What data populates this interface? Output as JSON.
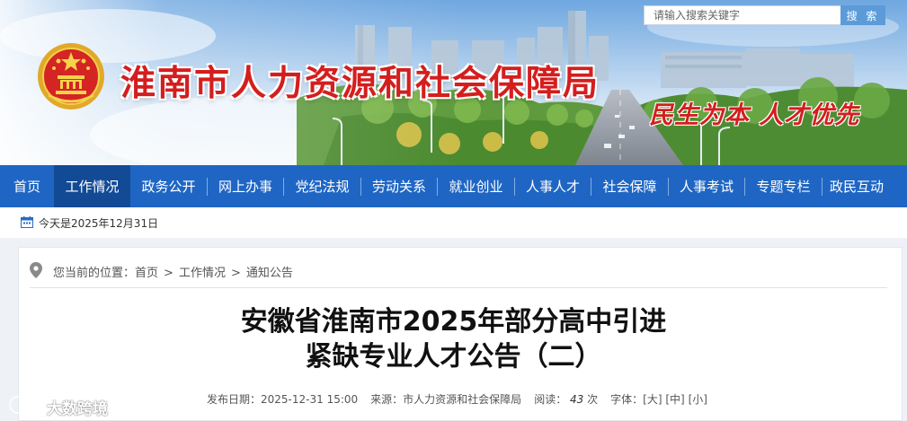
{
  "header": {
    "site_title": "淮南市人力资源和社会保障局",
    "slogan": "民生为本  人才优先",
    "emblem": "national-emblem-icon"
  },
  "nav": {
    "items": [
      {
        "label": "首页",
        "active": false
      },
      {
        "label": "工作情况",
        "active": true
      },
      {
        "label": "政务公开",
        "active": false
      },
      {
        "label": "网上办事",
        "active": false
      },
      {
        "label": "党纪法规",
        "active": false
      },
      {
        "label": "劳动关系",
        "active": false
      },
      {
        "label": "就业创业",
        "active": false
      },
      {
        "label": "人事人才",
        "active": false
      },
      {
        "label": "社会保障",
        "active": false
      },
      {
        "label": "人事考试",
        "active": false
      },
      {
        "label": "专题专栏",
        "active": false
      },
      {
        "label": "政民互动",
        "active": false
      }
    ]
  },
  "toolbar": {
    "today": "今天是2025年12月31日",
    "search_placeholder": "请输入搜索关键字",
    "search_button": "搜 索"
  },
  "breadcrumb": {
    "prefix": "您当前的位置：",
    "items": [
      "首页",
      "工作情况",
      "通知公告"
    ]
  },
  "article": {
    "title_line1": "安徽省淮南市2025年部分高中引进",
    "title_line2": "紧缺专业人才公告（二）",
    "meta": {
      "date_label": "发布日期：",
      "date": "2025-12-31 15:00",
      "source_label": "来源：",
      "source": "市人力资源和社会保障局",
      "views_label": "阅读：",
      "views": "43",
      "views_unit": "次",
      "font_label": "字体：",
      "font_large": "[大]",
      "font_medium": "[中]",
      "font_small": "[小]"
    }
  },
  "watermark": {
    "text": "大数跨境"
  },
  "colors": {
    "nav_bg": "#1f66c4",
    "nav_active": "#134a96",
    "title_red": "#d41e1e",
    "search_btn": "#5c9bd8"
  }
}
